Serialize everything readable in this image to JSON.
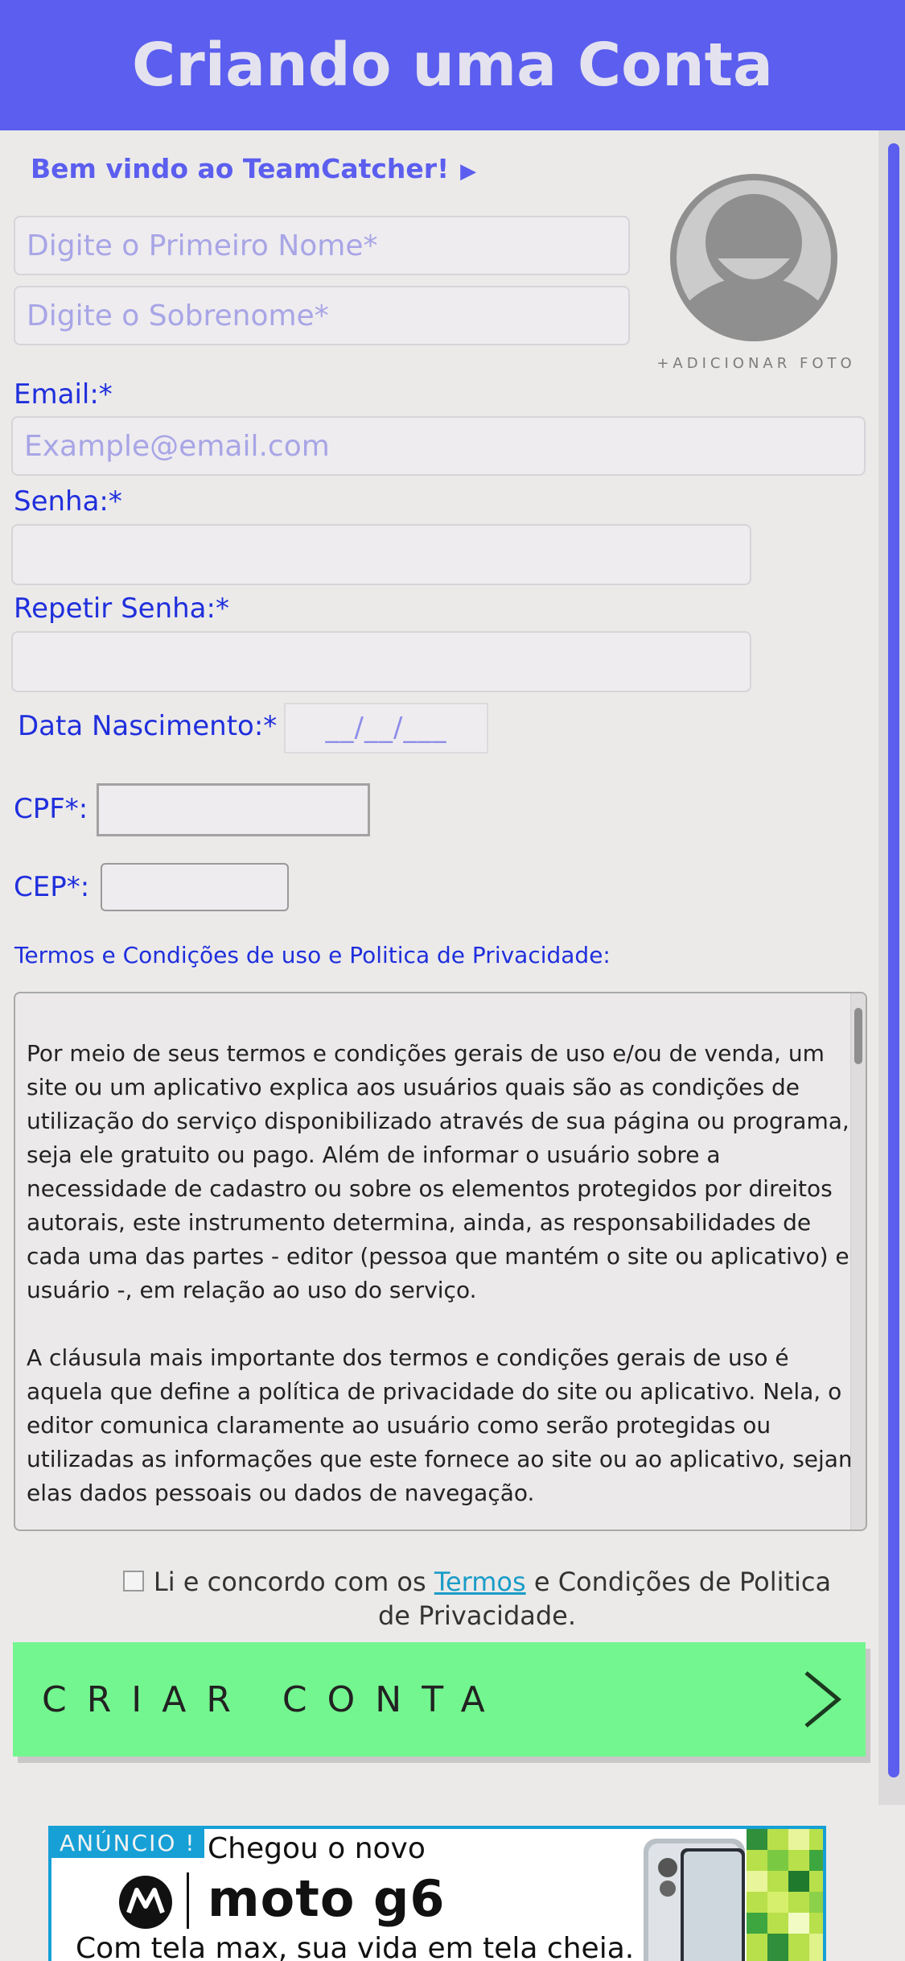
{
  "header": {
    "title": "Criando uma Conta"
  },
  "welcome": {
    "text": "Bem vindo ao TeamCatcher!",
    "arrow": "▶"
  },
  "form": {
    "first_name_placeholder": "Digite o Primeiro Nome*",
    "last_name_placeholder": "Digite o Sobrenome*",
    "add_photo": "+ADICIONAR FOTO",
    "email_label": "Email:*",
    "email_placeholder": "Example@email.com",
    "password_label": "Senha:*",
    "repeat_password_label": "Repetir Senha:*",
    "birthdate_label": "Data Nascimento:*",
    "birthdate_mask": "__/__/___",
    "cpf_label": "CPF*:",
    "cep_label": "CEP*:"
  },
  "terms": {
    "title": "Termos e Condições de uso e Politica de Privacidade:",
    "paragraphs": [
      "Por meio de seus termos e condições gerais de uso e/ou de venda, um site ou um aplicativo explica aos usuários quais são as condições de utilização do serviço disponibilizado através de sua página ou programa, seja ele gratuito ou pago. Além de informar o usuário sobre a necessidade de cadastro ou sobre os elementos protegidos por direitos autorais, este instrumento determina, ainda, as responsabilidades de cada uma das partes - editor (pessoa que mantém o site ou aplicativo) e usuário -, em relação ao uso do serviço.",
      "A cláusula mais importante dos termos e condições gerais de uso é aquela que define a política de privacidade do site ou aplicativo. Nela, o editor comunica claramente ao usuário como serão protegidas ou utilizadas as informações que este fornece ao site ou ao aplicativo, sejam elas dados pessoais ou dados de navegação."
    ],
    "agree_prefix": "Li e concordo com os",
    "agree_link": "Termos",
    "agree_suffix": "e Condições de Politica de Privacidade.",
    "agree_checked": false
  },
  "actions": {
    "create_account_label": "CRIAR CONTA",
    "arrow_icon": "chevron-right-icon"
  },
  "ad": {
    "tag": "ANÚNCIO !",
    "line1": "Chegou o novo",
    "brand": "moto g6",
    "line3": "Com tela max, sua vida em tela cheia."
  },
  "colors": {
    "header_bg": "#5b5eee",
    "label_blue": "#1f2fdc",
    "button_green": "#73f68f",
    "ad_border": "#16a0d6"
  }
}
